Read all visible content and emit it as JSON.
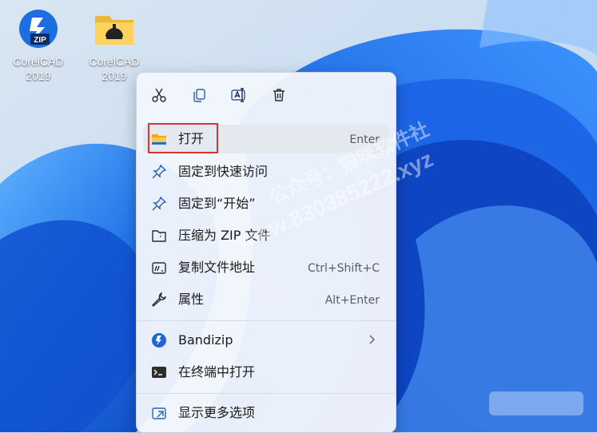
{
  "desktop": {
    "icons": [
      {
        "label_line1": "CorelCAD",
        "label_line2": "2019",
        "icon": "zip-file-icon"
      },
      {
        "label_line1": "CorelCAD",
        "label_line2": "2019",
        "icon": "folder-icon"
      }
    ],
    "watermark": {
      "line1": "公众号：猫咪软件社",
      "line2": "www.8303852​22.xyz"
    }
  },
  "context_menu": {
    "toolbar": [
      {
        "name": "cut",
        "icon": "scissors-icon"
      },
      {
        "name": "copy",
        "icon": "copy-icon"
      },
      {
        "name": "rename",
        "icon": "rename-icon"
      },
      {
        "name": "delete",
        "icon": "trash-icon"
      }
    ],
    "items": [
      {
        "label": "打开",
        "shortcut": "Enter",
        "icon": "folder-icon"
      },
      {
        "label": "固定到快速访问",
        "shortcut": "",
        "icon": "pin-icon"
      },
      {
        "label": "固定到“开始”",
        "shortcut": "",
        "icon": "pin-icon"
      },
      {
        "label": "压缩为 ZIP 文件",
        "shortcut": "",
        "icon": "zip-archive-icon"
      },
      {
        "label": "复制文件地址",
        "shortcut": "Ctrl+Shift+C",
        "icon": "path-icon"
      },
      {
        "label": "属性",
        "shortcut": "Alt+Enter",
        "icon": "wrench-icon"
      },
      {
        "label": "Bandizip",
        "shortcut": "",
        "icon": "bandizip-icon",
        "has_submenu": true
      },
      {
        "label": "在终端中打开",
        "shortcut": "",
        "icon": "terminal-icon"
      },
      {
        "label": "显示更多选项",
        "shortcut": "",
        "icon": "more-options-icon"
      }
    ]
  },
  "colors": {
    "accent": "#0067c0",
    "highlight_border": "#e0312e",
    "menu_bg": "#f2f6fc"
  }
}
